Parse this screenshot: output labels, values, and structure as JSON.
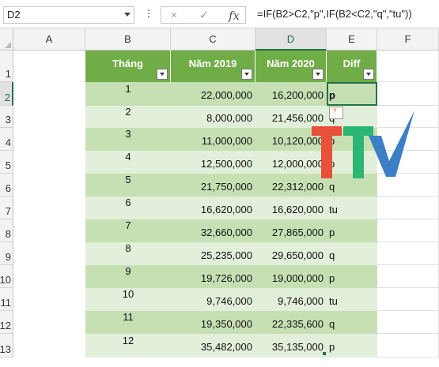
{
  "formula_bar": {
    "name_box": "D2",
    "cancel_icon": "×",
    "enter_icon": "✓",
    "fx_label": "fx",
    "formula": "=IF(B2>C2,\"p\",IF(B2<C2,\"q\",\"tu\"))"
  },
  "columns": [
    "A",
    "B",
    "C",
    "D",
    "E",
    "F"
  ],
  "rows": [
    "1",
    "2",
    "3",
    "4",
    "5",
    "6",
    "7",
    "8",
    "9",
    "10",
    "11",
    "12",
    "13"
  ],
  "header": {
    "a": "Tháng",
    "b": "Năm 2019",
    "c": "Năm 2020",
    "d": "Diff"
  },
  "data": [
    {
      "month": "1",
      "y2019": "22,000,000",
      "y2020": "16,200,000",
      "diff": "p"
    },
    {
      "month": "2",
      "y2019": "8,000,000",
      "y2020": "21,456,000",
      "diff": "q"
    },
    {
      "month": "3",
      "y2019": "11,000,000",
      "y2020": "10,120,000",
      "diff": "p"
    },
    {
      "month": "4",
      "y2019": "12,500,000",
      "y2020": "12,000,000",
      "diff": "p"
    },
    {
      "month": "5",
      "y2019": "21,750,000",
      "y2020": "22,312,000",
      "diff": "q"
    },
    {
      "month": "6",
      "y2019": "16,620,000",
      "y2020": "16,620,000",
      "diff": "tu"
    },
    {
      "month": "7",
      "y2019": "32,660,000",
      "y2020": "27,865,000",
      "diff": "p"
    },
    {
      "month": "8",
      "y2019": "25,235,000",
      "y2020": "29,650,000",
      "diff": "q"
    },
    {
      "month": "9",
      "y2019": "19,726,000",
      "y2020": "19,000,000",
      "diff": "p"
    },
    {
      "month": "10",
      "y2019": "9,746,000",
      "y2020": "9,746,000",
      "diff": "tu"
    },
    {
      "month": "11",
      "y2019": "19,350,000",
      "y2020": "22,335,600",
      "diff": "q"
    },
    {
      "month": "12",
      "y2019": "35,482,000",
      "y2020": "35,135,000",
      "diff": "p"
    }
  ],
  "colors": {
    "header_green": "#70ad47",
    "band_dark": "#c6e0b4",
    "band_light": "#e2efda",
    "selection": "#217346",
    "logo_red": "#e8503a",
    "logo_green": "#2bb673",
    "logo_blue": "#3b7fc4"
  },
  "icons": {
    "quick_analysis": "quick-analysis-icon",
    "logo": "ttv-logo"
  }
}
